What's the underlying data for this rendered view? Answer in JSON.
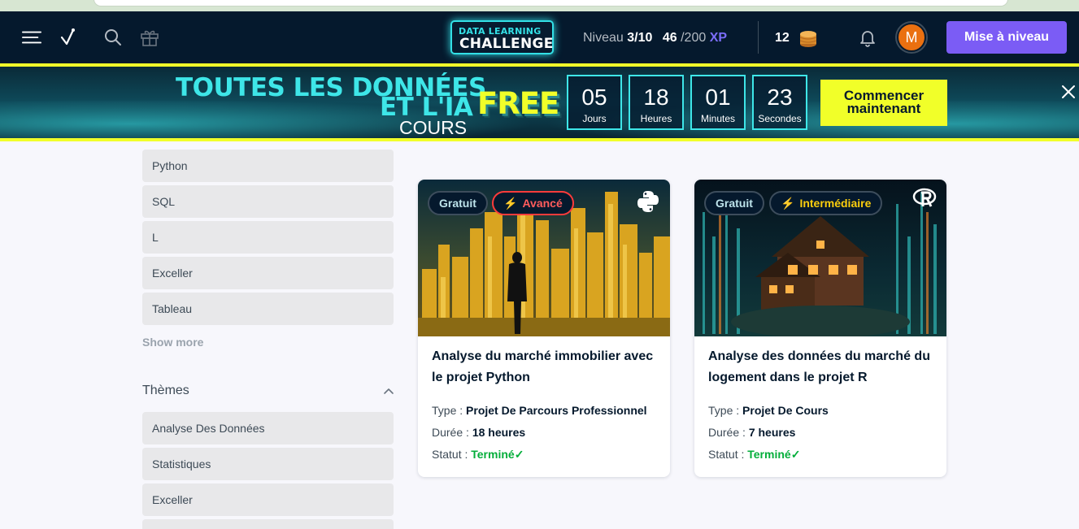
{
  "topnav": {
    "logo_line1": "DATA LEARNING",
    "logo_line2": "CHALLENGE",
    "level_label": "Niveau",
    "level_value": "3/10",
    "xp_current": "46",
    "xp_max": "/200",
    "xp_unit": "XP",
    "coins": "12",
    "avatar_letter": "M",
    "upgrade_label": "Mise à niveau"
  },
  "promo": {
    "line1": "TOUTES LES DONNÉES",
    "line2": "ET L'IA",
    "line3": "COURS",
    "free": "FREE",
    "timer": [
      {
        "value": "05",
        "unit": "Jours"
      },
      {
        "value": "18",
        "unit": "Heures"
      },
      {
        "value": "01",
        "unit": "Minutes"
      },
      {
        "value": "23",
        "unit": "Secondes"
      }
    ],
    "cta": "Commencer maintenant"
  },
  "sidebar": {
    "languages": [
      "Python",
      "SQL",
      "L",
      "Exceller",
      "Tableau"
    ],
    "show_more": "Show more",
    "themes_title": "Thèmes",
    "themes": [
      "Analyse Des Données",
      "Statistiques",
      "Exceller"
    ]
  },
  "cards": [
    {
      "badge_free": "Gratuit",
      "badge_level": "Avancé",
      "title": "Analyse du marché immobilier avec le projet Python",
      "type_label": "Type :",
      "type_value": "Projet De Parcours Professionnel",
      "duration_label": "Durée :",
      "duration_value": "18 heures",
      "status_label": "Statut :",
      "status_value": "Terminé",
      "language_icon": "python-icon"
    },
    {
      "badge_free": "Gratuit",
      "badge_level": "Intermédiaire",
      "title": "Analyse des données du marché du logement dans le projet R",
      "type_label": "Type :",
      "type_value": "Projet De Cours",
      "duration_label": "Durée :",
      "duration_value": "7 heures",
      "status_label": "Statut :",
      "status_value": "Terminé",
      "language_icon": "r-icon"
    }
  ],
  "colors": {
    "nav_bg": "#05192d",
    "accent_yellow": "#f1ff29",
    "accent_cyan": "#3ee6e8",
    "upgrade": "#7b5cf5",
    "advanced": "#ff3b3b",
    "intermediate": "#fcce0d",
    "done": "#03ae3a"
  }
}
